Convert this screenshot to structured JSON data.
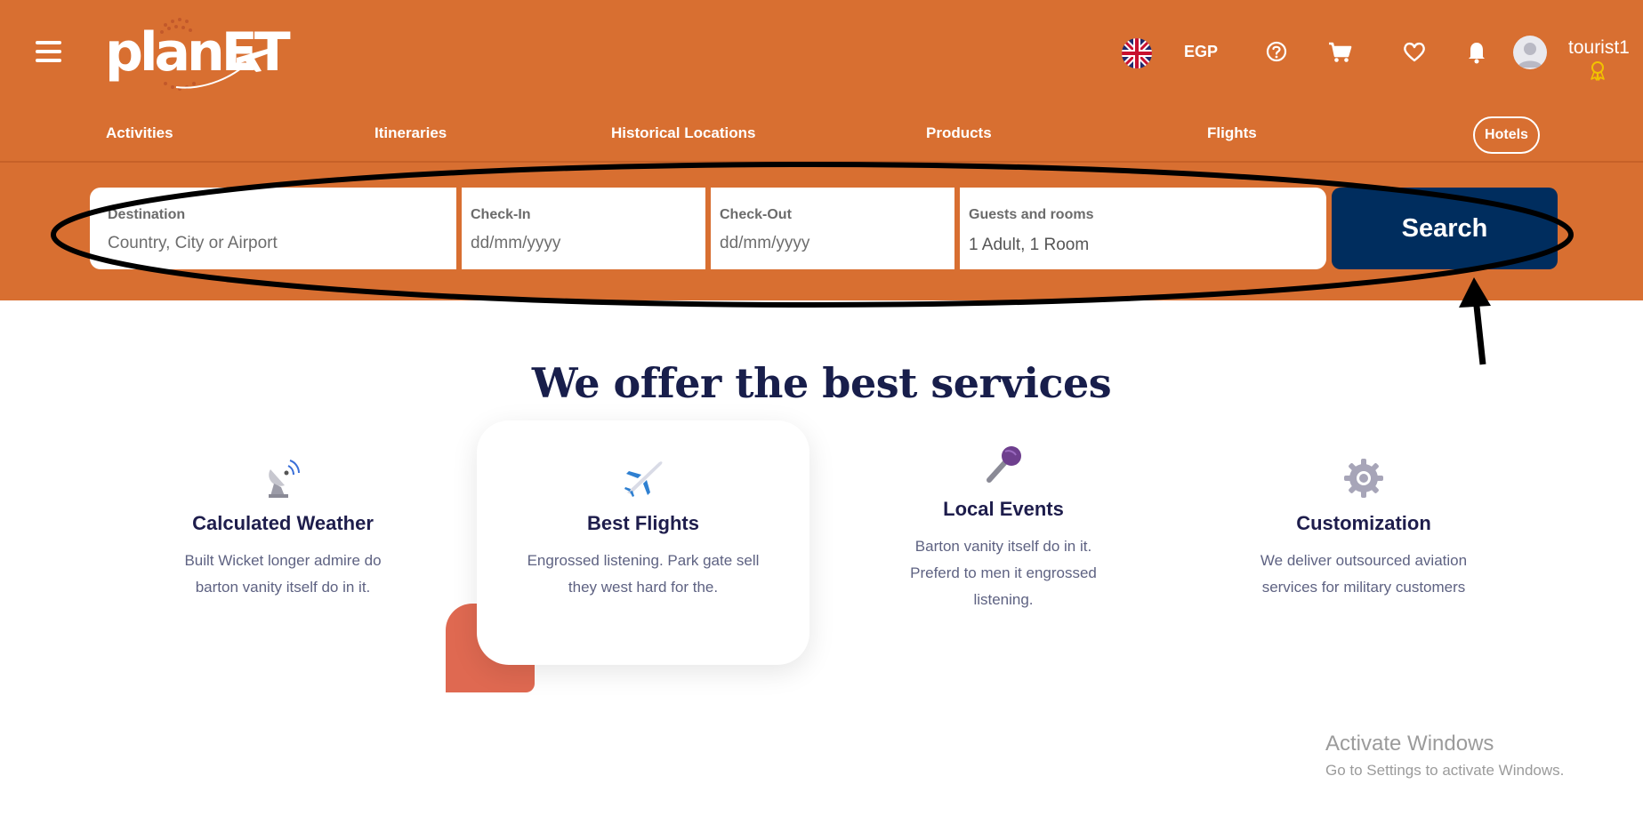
{
  "brand": {
    "logo_text": "planET"
  },
  "header": {
    "currency": "EGP",
    "username": "tourist1"
  },
  "nav": {
    "items": [
      {
        "label": "Activities"
      },
      {
        "label": "Itineraries"
      },
      {
        "label": "Historical Locations"
      },
      {
        "label": "Products"
      },
      {
        "label": "Flights"
      },
      {
        "label": "Hotels",
        "active": true
      }
    ]
  },
  "search": {
    "destination": {
      "label": "Destination",
      "placeholder": "Country, City or Airport"
    },
    "checkin": {
      "label": "Check-In",
      "placeholder": "dd/mm/yyyy"
    },
    "checkout": {
      "label": "Check-Out",
      "placeholder": "dd/mm/yyyy"
    },
    "guests": {
      "label": "Guests and rooms",
      "value": "1 Adult, 1 Room"
    },
    "button_label": "Search"
  },
  "services": {
    "title": "We offer the best services",
    "items": [
      {
        "title": "Calculated Weather",
        "desc": "Built Wicket longer admire do barton vanity itself do in it.",
        "icon": "satellite-dish-icon"
      },
      {
        "title": "Best Flights",
        "desc": "Engrossed listening. Park gate sell they west hard for the.",
        "icon": "airplane-icon"
      },
      {
        "title": "Local Events",
        "desc": "Barton vanity itself do in it. Preferd to men it engrossed listening.",
        "icon": "microphone-icon"
      },
      {
        "title": "Customization",
        "desc": "We deliver outsourced aviation services for military customers",
        "icon": "gear-icon"
      }
    ]
  },
  "watermark": {
    "title": "Activate Windows",
    "subtitle": "Go to Settings to activate Windows."
  },
  "colors": {
    "header_bg": "#d86f31",
    "search_button": "#002d5e",
    "title_text": "#181e4b",
    "accent_square": "#df6951"
  }
}
